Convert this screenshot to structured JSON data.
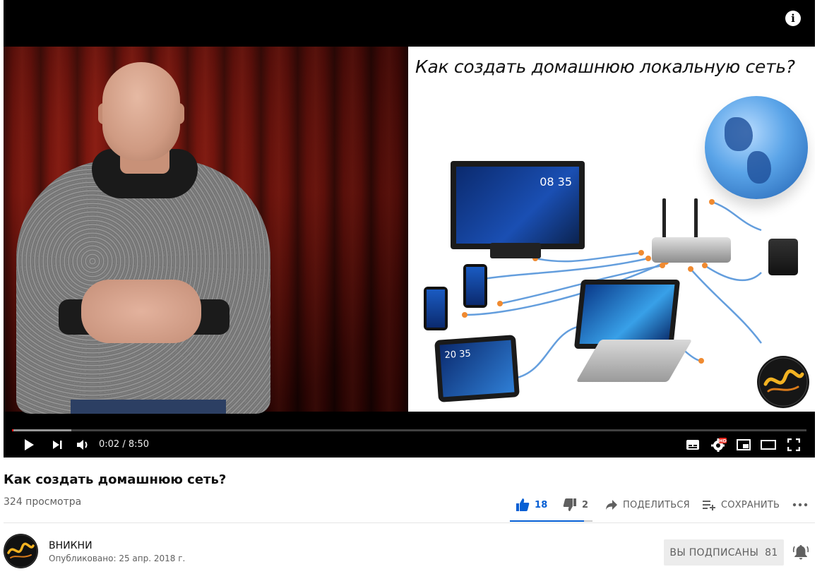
{
  "player": {
    "slide_title": "Как создать домашнюю локальную сеть?",
    "monitor_clock": "08 35",
    "tablet_clock": "20 35",
    "time_display": "0:02 / 8:50",
    "progress": {
      "played_fraction": 0.002,
      "loaded_fraction": 0.075
    },
    "info_icon": "i",
    "hd_badge": "HD",
    "icons": [
      "play-icon",
      "next-icon",
      "volume-icon",
      "subtitles-icon",
      "settings-icon",
      "miniplayer-icon",
      "theater-icon",
      "fullscreen-icon"
    ]
  },
  "video": {
    "title": "Как создать домашнюю сеть?",
    "views": "324 просмотра"
  },
  "actions": {
    "like_count": "18",
    "dislike_count": "2",
    "share_label": "ПОДЕЛИТЬСЯ",
    "save_label": "СОХРАНИТЬ",
    "like_fraction": 0.9
  },
  "owner": {
    "channel_name": "ВНИКНИ",
    "published": "Опубликовано: 25 апр. 2018 г.",
    "subscribed_label": "ВЫ ПОДПИСАНЫ",
    "subscriber_count": "81"
  },
  "colors": {
    "accent": "#065fd4",
    "progress": "#ff0000",
    "subscribed_bg": "#ececec"
  }
}
